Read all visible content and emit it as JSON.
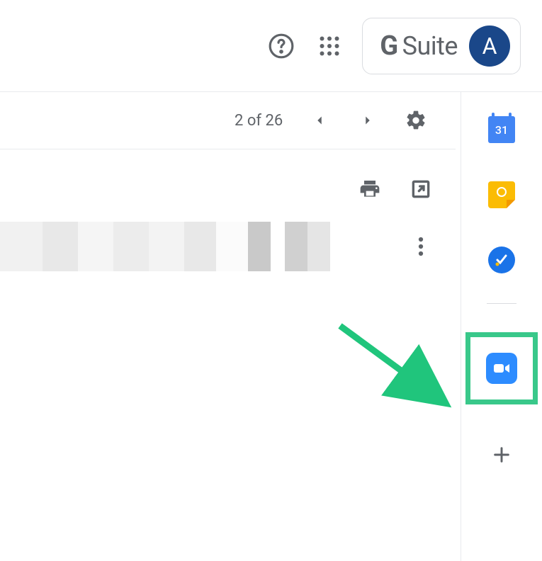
{
  "header": {
    "suite_label_prefix": "G",
    "suite_label_rest": " Suite",
    "avatar_initial": "A"
  },
  "toolbar": {
    "page_counter": "2 of 26"
  },
  "sidebar": {
    "calendar_day": "31"
  },
  "colors": {
    "highlight": "#39c88a",
    "zoom": "#2d8cff",
    "avatar": "#1a4789"
  }
}
